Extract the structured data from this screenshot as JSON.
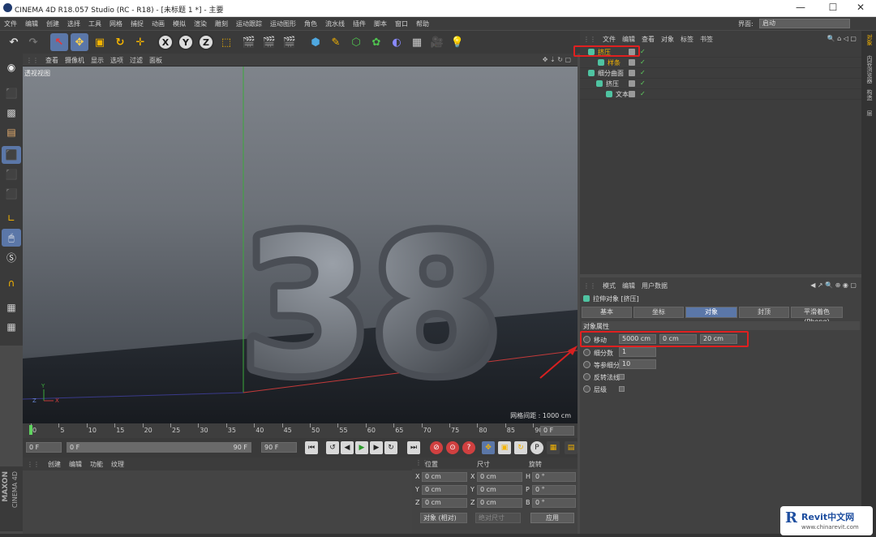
{
  "window": {
    "title": "CINEMA 4D R18.057 Studio (RC - R18) - [未标题 1 *] - 主要",
    "controls": [
      "—",
      "☐",
      "✕"
    ]
  },
  "menu": [
    "文件",
    "编辑",
    "创建",
    "选择",
    "工具",
    "网格",
    "捕捉",
    "动画",
    "模拟",
    "渲染",
    "雕刻",
    "运动跟踪",
    "运动图形",
    "角色",
    "流水线",
    "插件",
    "脚本",
    "窗口",
    "帮助"
  ],
  "layout": {
    "label": "界面:",
    "value": "启动"
  },
  "viewport": {
    "menu": [
      "查看",
      "摄像机",
      "显示",
      "选项",
      "过滤",
      "面板"
    ],
    "label": "透视视图",
    "grid_label": "网格间距 : 1000 cm",
    "text3d": "38",
    "axis": {
      "y": "Y",
      "z": "Z",
      "x": "X"
    }
  },
  "timeline": {
    "ticks": [
      "0",
      "5",
      "10",
      "15",
      "20",
      "25",
      "30",
      "35",
      "40",
      "45",
      "50",
      "55",
      "60",
      "65",
      "70",
      "75",
      "80",
      "85",
      "90"
    ],
    "frame": "0 F"
  },
  "playbar": {
    "start": "0 F",
    "slider_start": "0 F",
    "slider_end": "90 F",
    "end": "90 F"
  },
  "material": {
    "tabs": [
      "创建",
      "编辑",
      "功能",
      "纹理"
    ]
  },
  "coords": {
    "headers": [
      "位置",
      "尺寸",
      "旋转"
    ],
    "rows": [
      {
        "a": "X",
        "pos": "0 cm",
        "b": "X",
        "size": "0 cm",
        "c": "H",
        "rot": "0 °"
      },
      {
        "a": "Y",
        "pos": "0 cm",
        "b": "Y",
        "size": "0 cm",
        "c": "P",
        "rot": "0 °"
      },
      {
        "a": "Z",
        "pos": "0 cm",
        "b": "Z",
        "size": "0 cm",
        "c": "B",
        "rot": "0 °"
      }
    ],
    "mode": "对象 (相对)",
    "size_mode": "绝对尺寸",
    "apply": "应用"
  },
  "maxon": {
    "brand": "MAXON",
    "product": "CINEMA 4D"
  },
  "objects": {
    "menu": [
      "文件",
      "编辑",
      "查看",
      "对象",
      "标签",
      "书签"
    ],
    "rows": [
      {
        "name": "挤压",
        "indent": 10,
        "highlight": true
      },
      {
        "name": "样条",
        "indent": 22,
        "highlight": true
      },
      {
        "name": "细分曲面",
        "indent": 10,
        "highlight": false
      },
      {
        "name": "挤压",
        "indent": 20,
        "highlight": false
      },
      {
        "name": "文本",
        "indent": 32,
        "highlight": false
      }
    ]
  },
  "attributes": {
    "menu": [
      "模式",
      "编辑",
      "用户数据"
    ],
    "object_label": "拉伸对象 [挤压]",
    "tabs": [
      "基本",
      "坐标",
      "对象",
      "封顶",
      "平滑着色(Phong)"
    ],
    "section": "对象属性",
    "move_label": "移动",
    "move": [
      "5000 cm",
      "0 cm",
      "20 cm"
    ],
    "subdiv_label": "细分数",
    "subdiv": "1",
    "iso_label": "等参细分",
    "iso": "10",
    "flip_label": "反转法线",
    "hier_label": "层级"
  },
  "right_strip": [
    "对象",
    "内容浏览器",
    "构造",
    "层"
  ],
  "watermark": {
    "brand": "Revit中文网",
    "url": "www.chinarevit.com"
  },
  "colors": {
    "accent": "#5b77a8",
    "highlight": "#e02020",
    "object_icon": "#4fc3a1"
  }
}
